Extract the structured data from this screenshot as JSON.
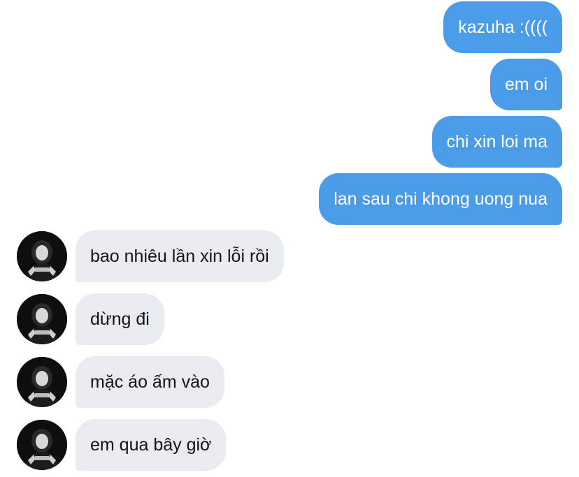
{
  "sent_messages": [
    {
      "text": "kazuha :(((("
    },
    {
      "text": "em oi"
    },
    {
      "text": "chi xin loi ma"
    },
    {
      "text": "lan sau chi khong uong nua"
    }
  ],
  "received_messages": [
    {
      "text": "bao nhiêu lần xin lỗi rồi"
    },
    {
      "text": "dừng đi"
    },
    {
      "text": "mặc áo ấm vào"
    },
    {
      "text": "em qua bây giờ"
    }
  ],
  "colors": {
    "sent_bubble": "#4a9be8",
    "received_bubble": "#e8ebf0",
    "sent_text": "#ffffff",
    "received_text": "#111418"
  }
}
